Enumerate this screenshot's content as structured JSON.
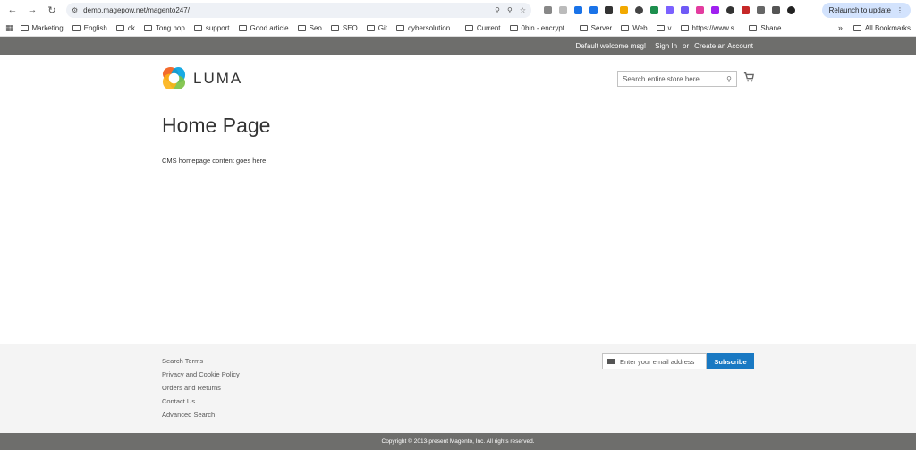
{
  "browser": {
    "url": "demo.magepow.net/magento247/",
    "relaunch_label": "Relaunch to update",
    "bookmarks": [
      "Marketing",
      "English",
      "ck",
      "Tong hop",
      "support",
      "Good article",
      "Seo",
      "SEO",
      "Git",
      "cybersolution...",
      "Current",
      "0bin - encrypt...",
      "Server",
      "Web",
      "v",
      "https://www.s...",
      "Shane"
    ],
    "all_bookmarks": "All Bookmarks"
  },
  "panel": {
    "welcome": "Default welcome msg!",
    "sign_in": "Sign In",
    "or": "or",
    "create_account": "Create an Account"
  },
  "header": {
    "logo_text": "LUMA",
    "search_placeholder": "Search entire store here..."
  },
  "main": {
    "title": "Home Page",
    "content": "CMS homepage content goes here."
  },
  "footer": {
    "links": [
      "Search Terms",
      "Privacy and Cookie Policy",
      "Orders and Returns",
      "Contact Us",
      "Advanced Search"
    ],
    "newsletter_placeholder": "Enter your email address",
    "subscribe": "Subscribe",
    "copyright": "Copyright © 2013-present Magento, Inc. All rights reserved."
  },
  "colors": {
    "panel_bg": "#6e6e6c",
    "subscribe_bg": "#1979c3",
    "footer_bg": "#f4f4f4"
  }
}
